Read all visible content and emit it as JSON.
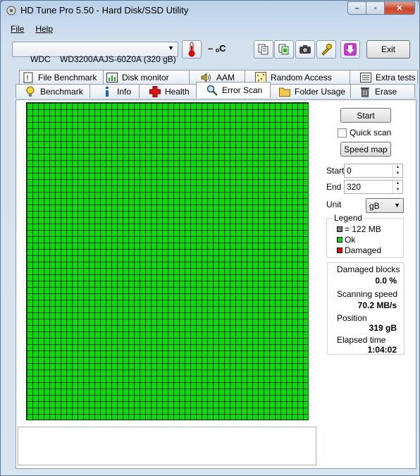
{
  "window": {
    "title": "HD Tune Pro 5.50 - Hard Disk/SSD Utility"
  },
  "menu": {
    "file": "File",
    "help": "Help"
  },
  "toolbar": {
    "drive": "WDC    WD3200AAJS-60Z0A (320 gB)",
    "temperature": "– ₒC",
    "exit_label": "Exit"
  },
  "tabs_top": [
    {
      "label": "File Benchmark"
    },
    {
      "label": "Disk monitor"
    },
    {
      "label": "AAM"
    },
    {
      "label": "Random Access"
    },
    {
      "label": "Extra tests"
    }
  ],
  "tabs_bottom": [
    {
      "label": "Benchmark"
    },
    {
      "label": "Info"
    },
    {
      "label": "Health"
    },
    {
      "label": "Error Scan"
    },
    {
      "label": "Folder Usage"
    },
    {
      "label": "Erase"
    }
  ],
  "scan": {
    "start_label": "Start",
    "quick_scan_label": "Quick scan",
    "speed_map_label": "Speed map",
    "start_field_label": "Start",
    "start_value": "0",
    "end_field_label": "End",
    "end_value": "320",
    "unit_label": "Unit",
    "unit_value": "gB"
  },
  "legend": {
    "title": "Legend",
    "block_size": "= 122 MB",
    "ok": "Ok",
    "damaged": "Damaged",
    "colors": {
      "block": "#808080",
      "ok": "#00e000",
      "damaged": "#ff0000"
    }
  },
  "stats": {
    "damaged_blocks_label": "Damaged blocks",
    "damaged_blocks_value": "0.0 %",
    "scanning_speed_label": "Scanning speed",
    "scanning_speed_value": "70.2 MB/s",
    "position_label": "Position",
    "position_value": "319 gB",
    "elapsed_label": "Elapsed time",
    "elapsed_value": "1:04:02"
  }
}
